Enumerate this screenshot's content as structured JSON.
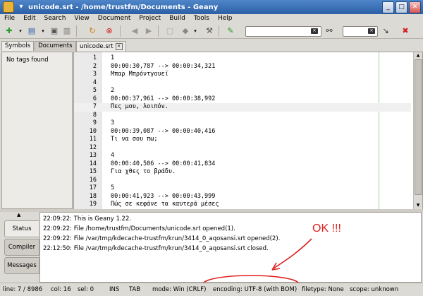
{
  "window": {
    "title": "unicode.srt - /home/trustfm/Documents - Geany",
    "min": "_",
    "max": "□",
    "close": "✕"
  },
  "menu": [
    "File",
    "Edit",
    "Search",
    "View",
    "Document",
    "Project",
    "Build",
    "Tools",
    "Help"
  ],
  "toolbar": {
    "search_placeholder": "",
    "goto_placeholder": ""
  },
  "sidebar": {
    "tabs": [
      "Symbols",
      "Documents"
    ],
    "empty_text": "No tags found"
  },
  "editor": {
    "tab_label": "unicode.srt",
    "current_line": 7,
    "lines": [
      {
        "n": "1",
        "t": "1"
      },
      {
        "n": "2",
        "t": "00:00:30,787 --> 00:00:34,321"
      },
      {
        "n": "3",
        "t": "Μπαρ Μπρόντγουεϊ"
      },
      {
        "n": "4",
        "t": ""
      },
      {
        "n": "5",
        "t": "2"
      },
      {
        "n": "6",
        "t": "00:00:37,961 --> 00:00:38,992"
      },
      {
        "n": "7",
        "t": "Πες μου, λοιπόν."
      },
      {
        "n": "8",
        "t": ""
      },
      {
        "n": "9",
        "t": "3"
      },
      {
        "n": "10",
        "t": "00:00:39,087 --> 00:00:40,416"
      },
      {
        "n": "11",
        "t": "Τι να σου πω;"
      },
      {
        "n": "12",
        "t": ""
      },
      {
        "n": "13",
        "t": "4"
      },
      {
        "n": "14",
        "t": "00:00:40,506 --> 00:00:41,834"
      },
      {
        "n": "15",
        "t": "Για χθες το βράδυ."
      },
      {
        "n": "16",
        "t": ""
      },
      {
        "n": "17",
        "t": "5"
      },
      {
        "n": "18",
        "t": "00:00:41,923 --> 00:00:43,999"
      },
      {
        "n": "19",
        "t": "Πώς σε κεφάνε τα καυτερά μέσες"
      }
    ]
  },
  "messages": {
    "tabs": [
      "Status",
      "Compiler",
      "Messages"
    ],
    "lines": [
      "22:09:22: This is Geany 1.22.",
      "22:09:22: File /home/trustfm/Documents/unicode.srt opened(1).",
      "22:09:22: File /var/tmp/kdecache-trustfm/krun/3414_0_aqosansi.srt opened(2).",
      "22:12:50: File /var/tmp/kdecache-trustfm/krun/3414_0_aqosansi.srt closed."
    ]
  },
  "annotation": {
    "text": "OK !!!",
    "color": "#e02020"
  },
  "status": {
    "line": "line: 7 / 8986",
    "col": "col: 16",
    "sel": "sel: 0",
    "ins": "INS",
    "tab": "TAB",
    "mode": "mode: Win (CRLF)",
    "encoding": "encoding: UTF-8 (with BOM)",
    "filetype": "filetype: None",
    "scope": "scope: unknown"
  }
}
